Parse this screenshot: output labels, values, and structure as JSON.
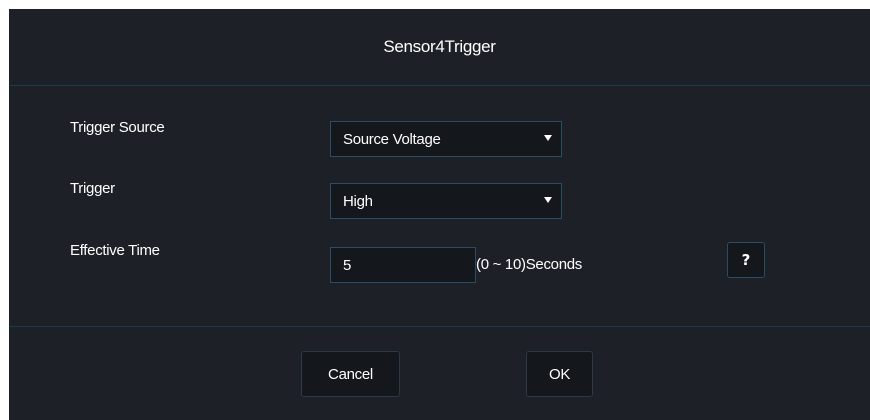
{
  "dialog": {
    "title": "Sensor4Trigger"
  },
  "fields": {
    "trigger_source": {
      "label": "Trigger Source",
      "value": "Source Voltage"
    },
    "trigger": {
      "label": "Trigger",
      "value": "High"
    },
    "effective_time": {
      "label": "Effective Time",
      "value": "5",
      "hint": "(0 ~ 10)Seconds"
    }
  },
  "help": {
    "label": "?"
  },
  "footer": {
    "cancel_label": "Cancel",
    "ok_label": "OK"
  },
  "colors": {
    "dialog_background": "#1d2127",
    "input_background": "#14171c",
    "border_accent": "#2b4d63",
    "divider": "#1a3a4e",
    "text": "#ffffff"
  },
  "icons": {
    "dropdown": "caret-down-icon",
    "help": "question-mark-icon"
  }
}
